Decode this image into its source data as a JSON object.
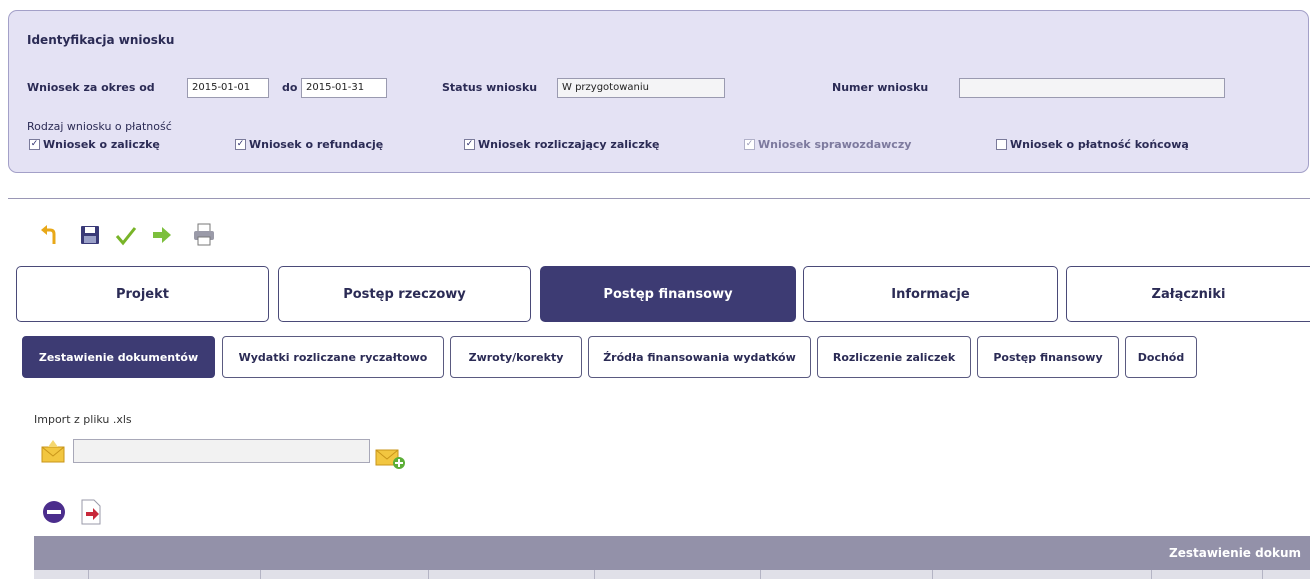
{
  "identification": {
    "title": "Identyfikacja wniosku",
    "period_from_label": "Wniosek za okres od",
    "period_from_value": "2015-01-01",
    "period_to_label": "do",
    "period_to_value": "2015-01-31",
    "status_label": "Status wniosku",
    "status_value": "W przygotowaniu",
    "number_label": "Numer wniosku",
    "number_value": "",
    "type_label": "Rodzaj wniosku o płatność",
    "types": [
      {
        "label": "Wniosek o zaliczkę",
        "checked": true,
        "disabled": false
      },
      {
        "label": "Wniosek o refundację",
        "checked": true,
        "disabled": false
      },
      {
        "label": "Wniosek rozliczający zaliczkę",
        "checked": true,
        "disabled": false
      },
      {
        "label": "Wniosek sprawozdawczy",
        "checked": true,
        "disabled": true
      },
      {
        "label": "Wniosek o płatność końcową",
        "checked": false,
        "disabled": false
      }
    ]
  },
  "toolbar": [
    "undo-icon",
    "save-icon",
    "check-icon",
    "send-arrow-icon",
    "print-icon"
  ],
  "main_tabs": [
    {
      "label": "Projekt",
      "active": false
    },
    {
      "label": "Postęp rzeczowy",
      "active": false
    },
    {
      "label": "Postęp finansowy",
      "active": true
    },
    {
      "label": "Informacje",
      "active": false
    },
    {
      "label": "Załączniki",
      "active": false
    }
  ],
  "sub_tabs": [
    {
      "label": "Zestawienie dokumentów",
      "active": true
    },
    {
      "label": "Wydatki rozliczane ryczałtowo",
      "active": false
    },
    {
      "label": "Zwroty/korekty",
      "active": false
    },
    {
      "label": "Źródła finansowania wydatków",
      "active": false
    },
    {
      "label": "Rozliczenie zaliczek",
      "active": false
    },
    {
      "label": "Postęp finansowy",
      "active": false
    },
    {
      "label": "Dochód",
      "active": false
    }
  ],
  "import": {
    "label": "Import z pliku .xls",
    "value": ""
  },
  "table": {
    "title": "Zestawienie dokum"
  },
  "colors": {
    "panel_bg": "#e4e2f4",
    "active_tab": "#3d3b73",
    "table_header": "#9391a9"
  }
}
